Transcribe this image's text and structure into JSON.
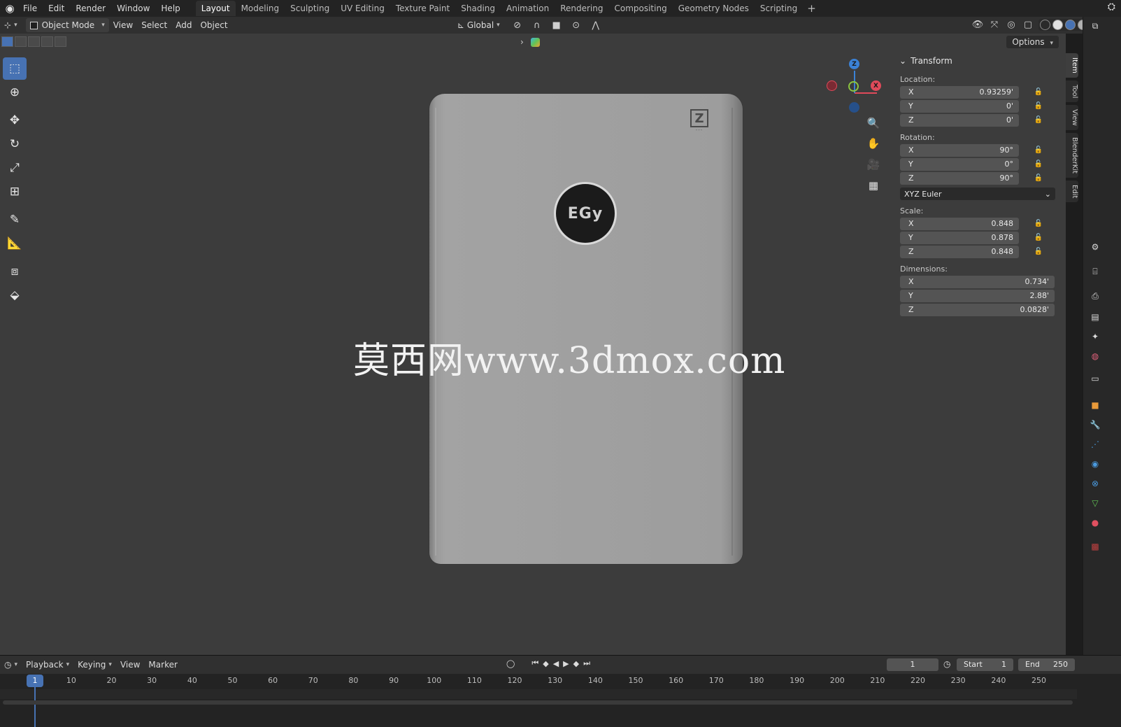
{
  "menu": [
    "File",
    "Edit",
    "Render",
    "Window",
    "Help"
  ],
  "workspaces": [
    "Layout",
    "Modeling",
    "Sculpting",
    "UV Editing",
    "Texture Paint",
    "Shading",
    "Animation",
    "Rendering",
    "Compositing",
    "Geometry Nodes",
    "Scripting"
  ],
  "active_workspace": "Layout",
  "header": {
    "mode": "Object Mode",
    "menus": [
      "View",
      "Select",
      "Add",
      "Object"
    ],
    "transform_orientation": "Global"
  },
  "viewport": {
    "options_label": "Options",
    "watermark": "莫西网www.3dmox.com",
    "object_badge": "EGy",
    "gizmo": {
      "x": "X",
      "y": "Y",
      "z": "Z"
    }
  },
  "npanel": {
    "title": "Transform",
    "location_label": "Location:",
    "location": [
      {
        "axis": "X",
        "value": "0.93259'"
      },
      {
        "axis": "Y",
        "value": "0'"
      },
      {
        "axis": "Z",
        "value": "0'"
      }
    ],
    "rotation_label": "Rotation:",
    "rotation": [
      {
        "axis": "X",
        "value": "90°"
      },
      {
        "axis": "Y",
        "value": "0°"
      },
      {
        "axis": "Z",
        "value": "90°"
      }
    ],
    "rotation_mode": "XYZ Euler",
    "scale_label": "Scale:",
    "scale": [
      {
        "axis": "X",
        "value": "0.848"
      },
      {
        "axis": "Y",
        "value": "0.878"
      },
      {
        "axis": "Z",
        "value": "0.848"
      }
    ],
    "dimensions_label": "Dimensions:",
    "dimensions": [
      {
        "axis": "X",
        "value": "0.734'"
      },
      {
        "axis": "Y",
        "value": "2.88'"
      },
      {
        "axis": "Z",
        "value": "0.0828'"
      }
    ]
  },
  "side_tabs": [
    "Item",
    "Tool",
    "View",
    "BlenderKit",
    "Edit"
  ],
  "timeline": {
    "menus": [
      "Playback",
      "Keying",
      "View",
      "Marker"
    ],
    "current_frame": "1",
    "start_label": "Start",
    "start": "1",
    "end_label": "End",
    "end": "250",
    "ticks": [
      "10",
      "20",
      "30",
      "40",
      "50",
      "60",
      "70",
      "80",
      "90",
      "100",
      "110",
      "120",
      "130",
      "140",
      "150",
      "160",
      "170",
      "180",
      "190",
      "200",
      "210",
      "220",
      "230",
      "240",
      "250"
    ],
    "marker": "1"
  },
  "colors": {
    "accent": "#4772b3",
    "axis_x": "#e04a5a",
    "axis_y": "#8cc63f",
    "axis_z": "#3b82d6",
    "viewport_bg": "#3c3c3c"
  }
}
